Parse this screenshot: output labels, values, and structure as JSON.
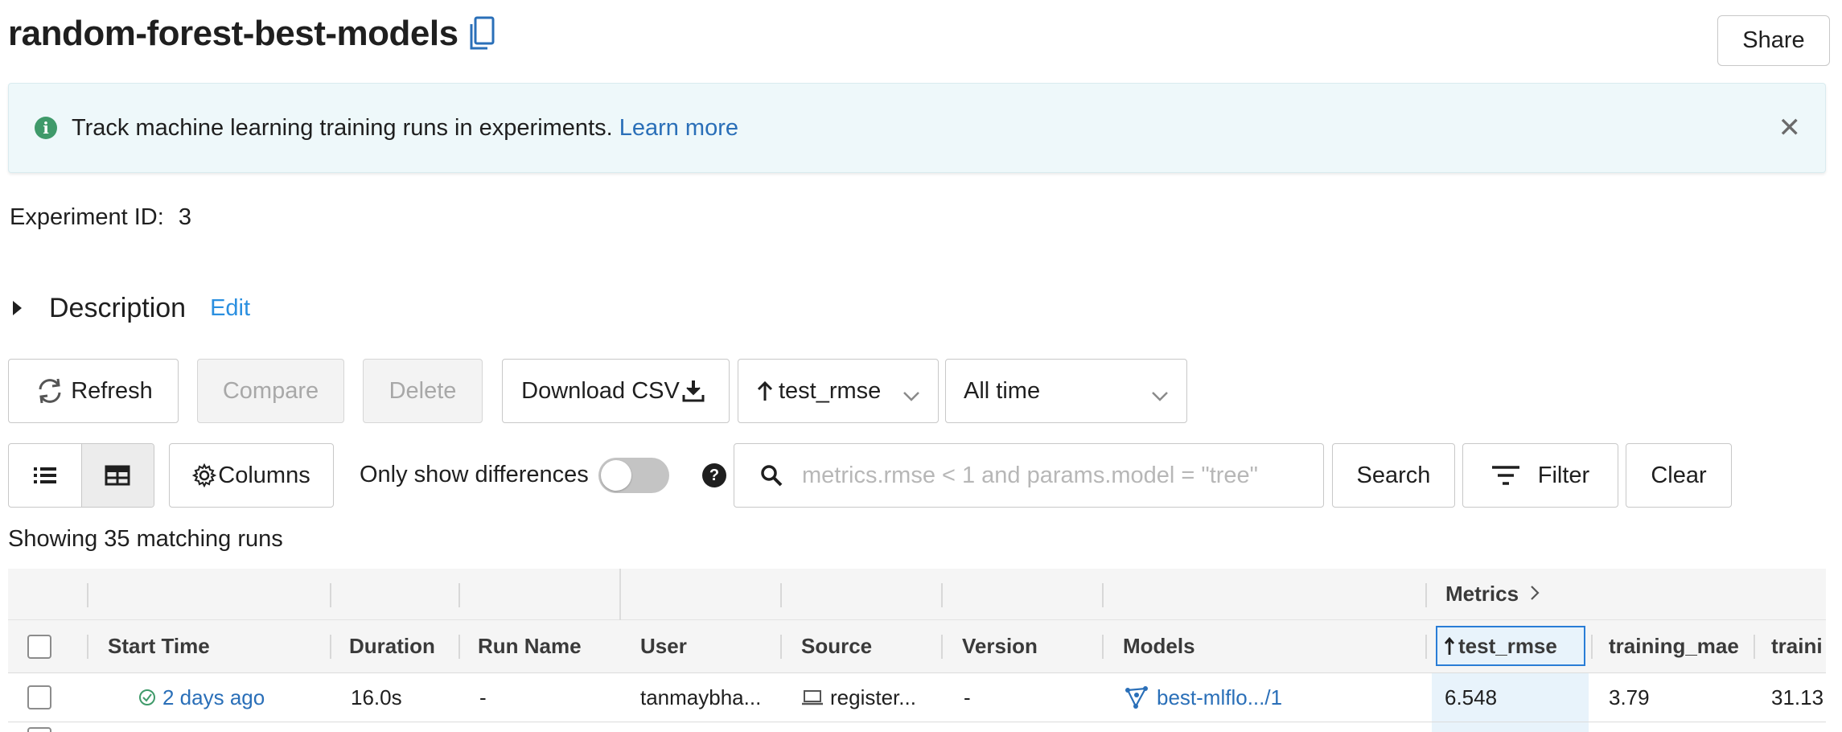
{
  "header": {
    "title": "random-forest-best-models",
    "share_label": "Share"
  },
  "banner": {
    "text": "Track machine learning training runs in experiments.",
    "link": "Learn more"
  },
  "experiment": {
    "id_label": "Experiment ID:",
    "id_value": "3"
  },
  "description": {
    "label": "Description",
    "edit": "Edit"
  },
  "toolbar": {
    "refresh": "Refresh",
    "compare": "Compare",
    "delete": "Delete",
    "download_csv": "Download CSV",
    "sort_value": "test_rmse",
    "time_value": "All time"
  },
  "toolbar2": {
    "columns": "Columns",
    "only_diff": "Only show differences",
    "search_placeholder": "metrics.rmse < 1 and params.model = \"tree\"",
    "search": "Search",
    "filter": "Filter",
    "clear": "Clear"
  },
  "results": {
    "count_text": "Showing 35 matching runs"
  },
  "table": {
    "group_metrics": "Metrics",
    "columns": [
      "Start Time",
      "Duration",
      "Run Name",
      "User",
      "Source",
      "Version",
      "Models",
      "test_rmse",
      "training_mae",
      "traini"
    ],
    "row": {
      "start_time": "2 days ago",
      "duration": "16.0s",
      "run_name": "-",
      "user": "tanmaybha...",
      "source": "register...",
      "version": "-",
      "model": "best-mlflo.../1",
      "test_rmse": "6.548",
      "training_mae": "3.79",
      "training_3": "31.13"
    }
  },
  "colors": {
    "accent": "#2a6fb8",
    "banner_bg": "#eef8fa",
    "success": "#3f9a6a"
  }
}
